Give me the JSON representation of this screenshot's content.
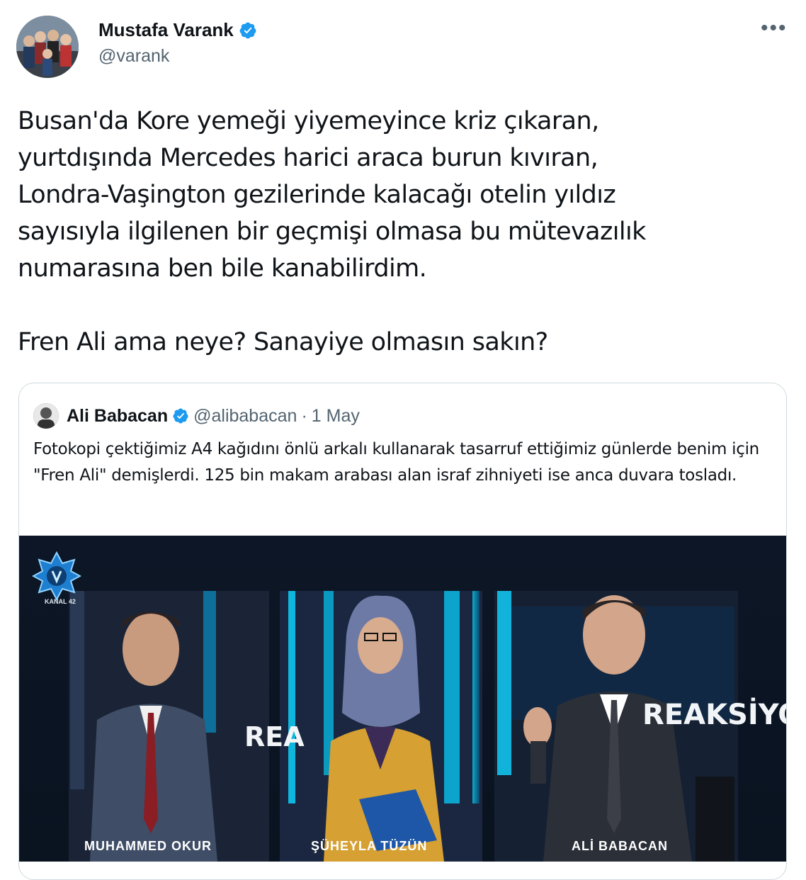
{
  "author": {
    "name": "Mustafa Varank",
    "handle": "@varank"
  },
  "more_label": "•••",
  "tweet": {
    "text": "Busan'da Kore yemeği yiyemeyince kriz çıkaran,\nyurtdışında Mercedes harici araca burun kıvıran,\nLondra-Vaşington gezilerinde kalacağı otelin yıldız\nsayısıyla ilgilenen bir geçmişi olmasa bu mütevazılık\nnumarasına ben bile kanabilirdim.\n\nFren Ali ama neye? Sanayiye olmasın sakın?"
  },
  "quoted": {
    "name": "Ali Babacan",
    "handle": "@alibabacan",
    "dot": "·",
    "date": "1 May",
    "text": "Fotokopi çektiğimiz A4 kağıdını önlü arkalı kullanarak tasarruf ettiğimiz günlerde benim için \"Fren Ali\" demişlerdi. 125 bin makam arabası alan israf zihniyeti ise anca duvara tosladı.",
    "media": {
      "logo_text": "KANAL 42",
      "set_text_left": "REA",
      "set_text_right": "REAKSİYO",
      "captions": [
        "MUHAMMED OKUR",
        "ŞÜHEYLA TÜZÜN",
        "ALİ BABACAN"
      ]
    }
  },
  "colors": {
    "verified": "#1d9bf0",
    "secondary_text": "#536471",
    "border": "#cfd9de"
  }
}
